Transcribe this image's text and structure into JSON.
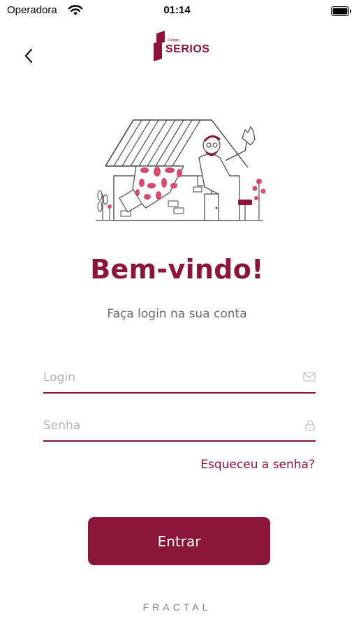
{
  "status_bar": {
    "carrier": "Operadora",
    "time": "01:14"
  },
  "header": {
    "logo_small": "Colégio",
    "logo_text": "SERIOS"
  },
  "login": {
    "title": "Bem-vindo!",
    "subtitle": "Faça login na sua conta",
    "login_placeholder": "Login",
    "password_placeholder": "Senha",
    "forgot_password": "Esqueceu a senha?",
    "submit_label": "Entrar"
  },
  "footer": {
    "brand": "FRACTAL"
  },
  "colors": {
    "brand": "#8a1538",
    "accent_pink": "#d64a6e",
    "muted_text": "#6b6b6b",
    "footer_text": "#7c8590"
  },
  "icons": {
    "back": "chevron-left-icon",
    "login_field": "mail-icon",
    "password_field": "lock-icon"
  }
}
